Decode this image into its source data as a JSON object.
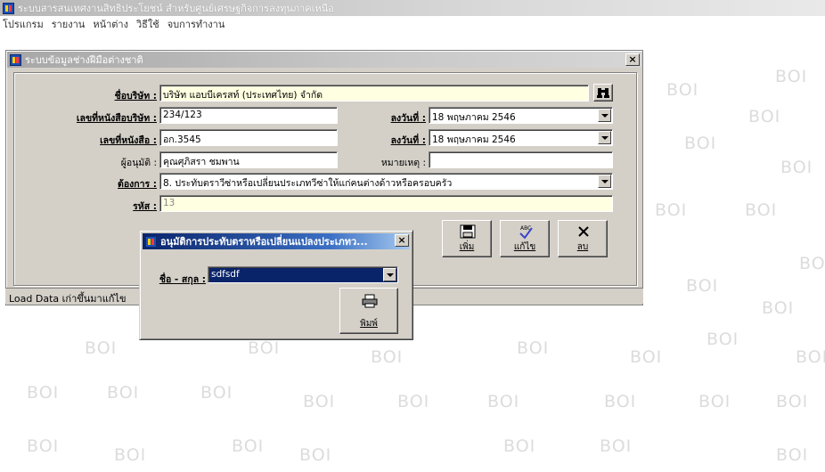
{
  "app": {
    "title": "ระบบสารสนเทศงานสิทธิประโยชน์ สำหรับศูนย์เศรษฐกิจการลงทุนภาคเหนือ"
  },
  "menu": [
    "โปรแกรม",
    "รายงาน",
    "หน้าต่าง",
    "วิธีใช้",
    "จบการทำงาน"
  ],
  "watermark": "BOI",
  "window": {
    "title": "ระบบข้อมูลช่างฝีมือต่างชาติ",
    "labels": {
      "company": "ชื่อบริษัท :",
      "cert_no": "เลขที่หนังสือบริษัท :",
      "doc_no": "เลขที่หนังสือ :",
      "date1": "ลงวันที่ :",
      "date2": "ลงวันที่ :",
      "approver": "ผู้อนุมัติ :",
      "note": "หมายเหตุ :",
      "request": "ต้องการ :",
      "code": "รหัส :"
    },
    "values": {
      "company": "บริษัท แอบบีเครสท์ (ประเทศไทย) จำกัด",
      "cert_no": "234/123",
      "doc_no": "อก.3545",
      "date1": "18 พฤษภาคม  2546",
      "date2": "18 พฤษภาคม  2546",
      "approver": "คุณศุภิสรา ชมพาน",
      "note": "",
      "request": "8. ประทับตราวีซ่าหรือเปลี่ยนประเภทวีซ่าให้แก่คนต่างด้าวหรือครอบครัว",
      "code": "13"
    },
    "buttons": {
      "add": "เพิ่ม",
      "edit": "แก้ไข",
      "delete": "ลบ"
    },
    "close": "×"
  },
  "status": {
    "text": "Load Data เก่าขึ้นมาแก้ไข"
  },
  "dialog": {
    "title": "อนุมัติการประทับตราหรือเปลี่ยนแปลงประเภทว...",
    "name_label": "ชื่อ - สกุล :",
    "name_value": "sdfsdf",
    "print": "พิมพ์",
    "close": "×"
  },
  "colors": {
    "accent": "#0a246a",
    "form_bg": "#d4d0c8",
    "readonly_bg": "#ffffe1"
  }
}
